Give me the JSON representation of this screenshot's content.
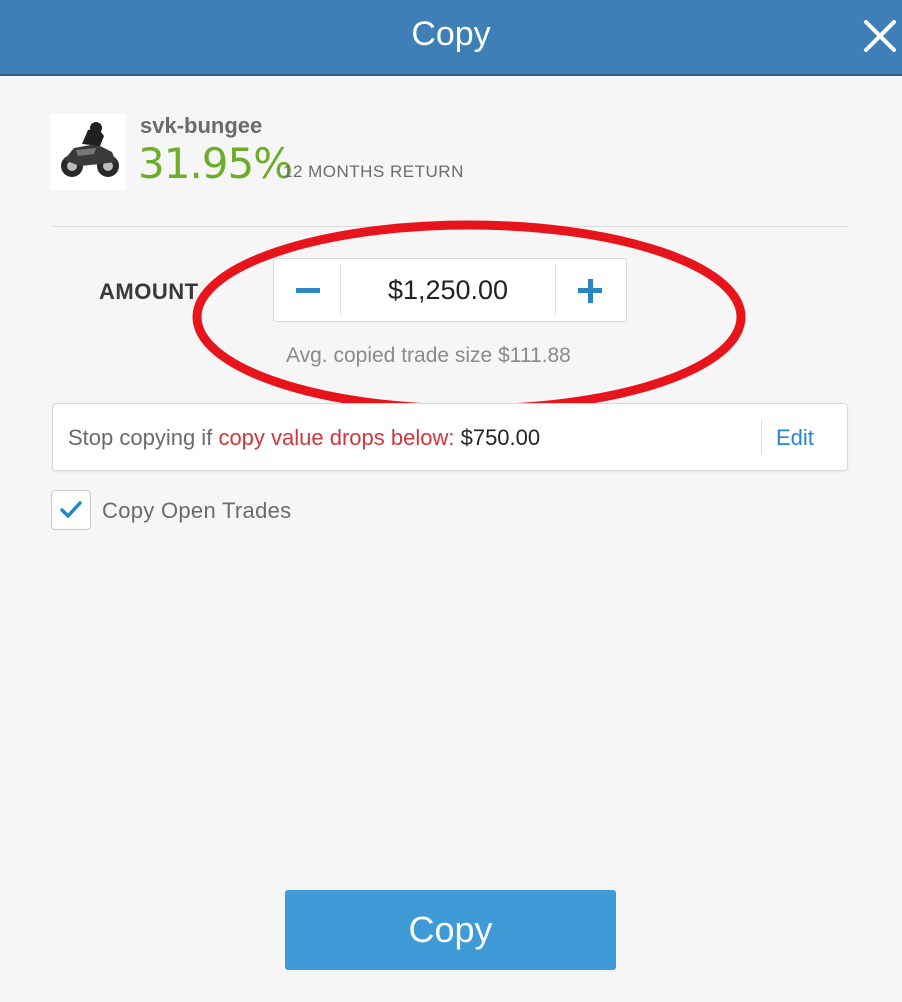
{
  "header": {
    "title": "Copy",
    "close_icon": "close-icon"
  },
  "trader": {
    "avatar_icon": "motorcycle-avatar",
    "username": "svk-bungee",
    "return_value": "31.95%",
    "return_label": "12 MONTHS RETURN"
  },
  "amount": {
    "label": "AMOUNT",
    "value": "$1,250.00",
    "minus_icon": "minus-icon",
    "plus_icon": "plus-icon",
    "avg_trade_size": "Avg. copied trade size $111.88"
  },
  "stop_loss": {
    "prefix": "Stop copying if",
    "highlight": "copy value drops below:",
    "value": "$750.00",
    "edit_label": "Edit"
  },
  "copy_open_trades": {
    "checked": true,
    "label": "Copy Open Trades"
  },
  "footer": {
    "copy_button_label": "Copy"
  },
  "colors": {
    "header": "#3f7fb8",
    "return_green": "#6cad2a",
    "accent_blue": "#2b86c4",
    "button_blue": "#3f9ad8",
    "stop_red": "#d0373d",
    "annotation_red": "#e8141c"
  }
}
